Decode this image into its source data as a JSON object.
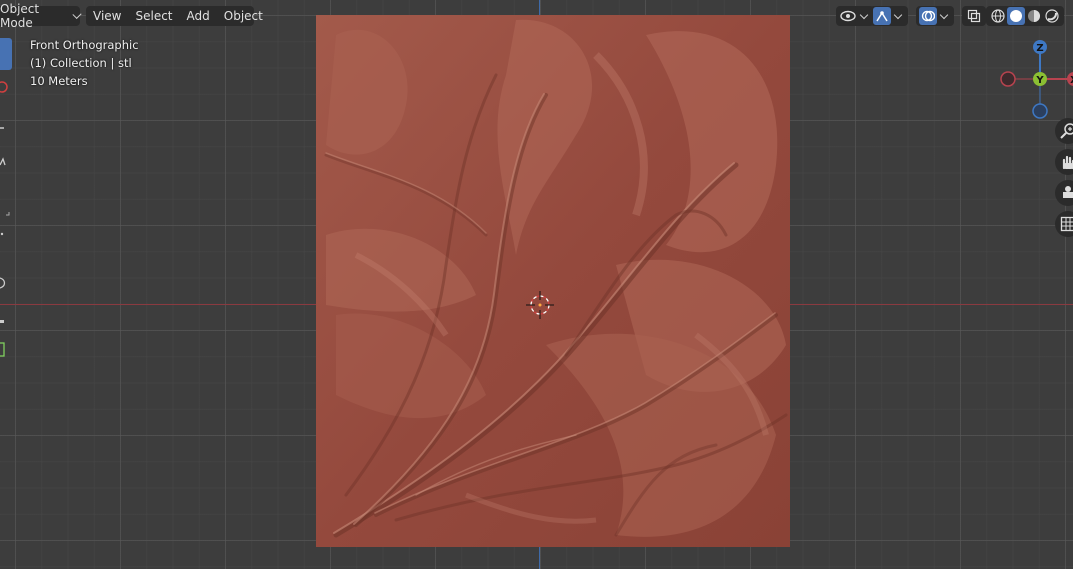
{
  "header": {
    "mode": "Object Mode",
    "menu": [
      "View",
      "Select",
      "Add",
      "Object"
    ]
  },
  "overlay": {
    "view_name": "Front Orthographic",
    "collection": "(1) Collection | stl",
    "scale": "10 Meters"
  },
  "gizmo": {
    "z_label": "Z",
    "y_label": "Y",
    "x_label": "X"
  },
  "colors": {
    "viewport_bg": "#3d3d3d",
    "relief": "#9b5144",
    "x_axis": "#b8434f",
    "y_axis": "#8bbf33",
    "z_axis": "#3e78c4",
    "active_button": "#4772b3"
  },
  "icons": {
    "header_right": [
      "visibility-icon",
      "gizmo-toggle-icon",
      "overlay-icon",
      "xray-icon",
      "wireframe-shading-icon",
      "solid-shading-icon",
      "material-shading-icon",
      "rendered-shading-icon"
    ],
    "navigation": [
      "zoom-icon",
      "pan-hand-icon",
      "camera-icon",
      "grid-ortho-icon"
    ]
  }
}
